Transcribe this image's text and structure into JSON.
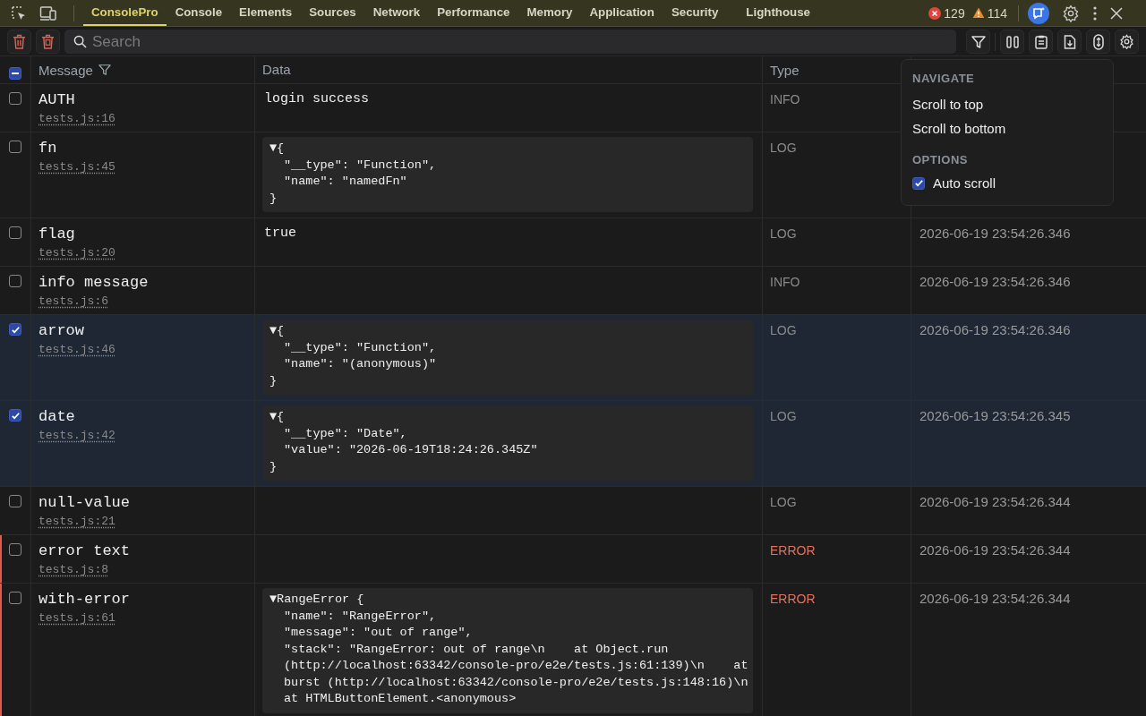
{
  "tabs": [
    {
      "label": "ConsolePro",
      "selected": true
    },
    {
      "label": "Console",
      "selected": false
    },
    {
      "label": "Elements",
      "selected": false
    },
    {
      "label": "Sources",
      "selected": false
    },
    {
      "label": "Network",
      "selected": false
    },
    {
      "label": "Performance",
      "selected": false
    },
    {
      "label": "Memory",
      "selected": false
    },
    {
      "label": "Application",
      "selected": false
    },
    {
      "label": "Security",
      "selected": false
    },
    {
      "label": "Lighthouse",
      "selected": false
    }
  ],
  "counts": {
    "errors": "129",
    "warnings": "114"
  },
  "search": {
    "placeholder": "Search"
  },
  "table": {
    "select_all": {
      "indeterminate": true
    },
    "columns": [
      "Message",
      "Data",
      "Type"
    ],
    "rows": [
      {
        "message": "AUTH",
        "source": "tests.js:16",
        "data": {
          "kind": "text",
          "text": "login success"
        },
        "type": "INFO",
        "kind": "info",
        "selected": false
      },
      {
        "message": "fn",
        "source": "tests.js:45",
        "data": {
          "kind": "object",
          "open": "▼{",
          "entries": [
            "\"__type\": \"Function\",",
            "\"name\": \"namedFn\""
          ],
          "close": "}"
        },
        "type": "LOG",
        "kind": "log",
        "selected": false
      },
      {
        "message": "flag",
        "source": "tests.js:20",
        "data": {
          "kind": "text",
          "text": "true"
        },
        "type": "LOG",
        "kind": "log",
        "time": "2026-06-19 23:54:26.346",
        "selected": false
      },
      {
        "message": "info message",
        "source": "tests.js:6",
        "type": "INFO",
        "kind": "info",
        "time": "2026-06-19 23:54:26.346",
        "selected": false
      },
      {
        "message": "arrow",
        "source": "tests.js:46",
        "data": {
          "kind": "object",
          "open": "▼{",
          "entries": [
            "\"__type\": \"Function\",",
            "\"name\": \"(anonymous)\""
          ],
          "close": "}"
        },
        "type": "LOG",
        "kind": "log",
        "time": "2026-06-19 23:54:26.346",
        "selected": true
      },
      {
        "message": "date",
        "source": "tests.js:42",
        "data": {
          "kind": "object",
          "open": "▼{",
          "entries": [
            "\"__type\": \"Date\",",
            "\"value\": \"2026-06-19T18:24:26.345Z\""
          ],
          "close": "}"
        },
        "type": "LOG",
        "kind": "log",
        "time": "2026-06-19 23:54:26.345",
        "selected": true
      },
      {
        "message": "null-value",
        "source": "tests.js:21",
        "type": "LOG",
        "kind": "log",
        "time": "2026-06-19 23:54:26.344",
        "selected": false
      },
      {
        "message": "error text",
        "source": "tests.js:8",
        "type": "ERROR",
        "kind": "error",
        "time": "2026-06-19 23:54:26.344",
        "selected": false
      },
      {
        "message": "with-error",
        "source": "tests.js:61",
        "data": {
          "kind": "object",
          "open": "▼RangeError {",
          "entries": [
            "\"name\": \"RangeError\",",
            "\"message\": \"out of range\",",
            "\"stack\": \"RangeError: out of range\\n    at Object.run (http://localhost:63342/console-pro/e2e/tests.js:61:139)\\n    at burst (http://localhost:63342/console-pro/e2e/tests.js:148:16)\\n    at HTMLButtonElement.<anonymous>"
          ]
        },
        "type": "ERROR",
        "kind": "error",
        "time": "2026-06-19 23:54:26.344",
        "selected": false
      }
    ]
  },
  "menu": {
    "sections": [
      {
        "heading": "NAVIGATE",
        "items": [
          {
            "kind": "action",
            "label": "Scroll to top"
          },
          {
            "kind": "action",
            "label": "Scroll to bottom"
          }
        ]
      },
      {
        "heading": "OPTIONS",
        "items": [
          {
            "kind": "checkbox",
            "label": "Auto scroll",
            "checked": true
          }
        ]
      }
    ]
  }
}
